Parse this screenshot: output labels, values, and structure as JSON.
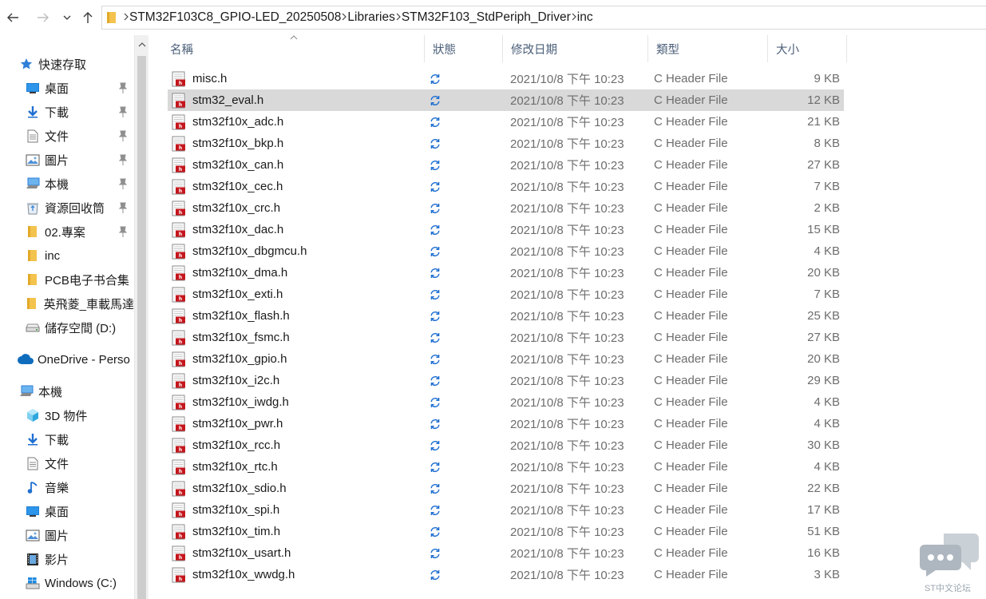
{
  "window": {
    "app": "File Explorer"
  },
  "nav": {
    "back_icon": "arrow-left-icon",
    "forward_icon": "arrow-right-icon",
    "recent_icon": "chevron-down-icon",
    "up_icon": "arrow-up-icon"
  },
  "breadcrumb": [
    "STM32F103C8_GPIO-LED_20250508",
    "Libraries",
    "STM32F103_StdPeriph_Driver",
    "inc"
  ],
  "sidebar": {
    "items": [
      {
        "label": "快速存取",
        "icon": "star-icon",
        "level": 0,
        "pinned": false
      },
      {
        "label": "桌面",
        "icon": "desktop-icon",
        "level": 1,
        "pinned": true
      },
      {
        "label": "下載",
        "icon": "download-icon",
        "level": 1,
        "pinned": true
      },
      {
        "label": "文件",
        "icon": "document-icon",
        "level": 1,
        "pinned": true
      },
      {
        "label": "圖片",
        "icon": "picture-icon",
        "level": 1,
        "pinned": true
      },
      {
        "label": "本機",
        "icon": "computer-icon",
        "level": 1,
        "pinned": true
      },
      {
        "label": "資源回收筒",
        "icon": "recycle-bin-icon",
        "level": 1,
        "pinned": true
      },
      {
        "label": "02.專案",
        "icon": "folder-icon",
        "level": 1,
        "pinned": true
      },
      {
        "label": "inc",
        "icon": "folder-icon",
        "level": 1,
        "pinned": false
      },
      {
        "label": "PCB电子书合集",
        "icon": "folder-icon",
        "level": 1,
        "pinned": false
      },
      {
        "label": "英飛菱_車載馬達",
        "icon": "folder-icon",
        "level": 1,
        "pinned": false
      },
      {
        "label": "儲存空間 (D:)",
        "icon": "drive-icon",
        "level": 1,
        "pinned": false
      },
      {
        "label": "OneDrive - Perso",
        "icon": "cloud-icon",
        "level": 0,
        "pinned": false
      },
      {
        "label": "本機",
        "icon": "computer-icon",
        "level": 0,
        "pinned": false
      },
      {
        "label": "3D 物件",
        "icon": "cube-3d-icon",
        "level": 1,
        "pinned": false
      },
      {
        "label": "下載",
        "icon": "download-icon",
        "level": 1,
        "pinned": false
      },
      {
        "label": "文件",
        "icon": "document-icon",
        "level": 1,
        "pinned": false
      },
      {
        "label": "音樂",
        "icon": "music-icon",
        "level": 1,
        "pinned": false
      },
      {
        "label": "桌面",
        "icon": "desktop-icon",
        "level": 1,
        "pinned": false
      },
      {
        "label": "圖片",
        "icon": "picture-icon",
        "level": 1,
        "pinned": false
      },
      {
        "label": "影片",
        "icon": "video-icon",
        "level": 1,
        "pinned": false
      },
      {
        "label": "Windows (C:)",
        "icon": "windows-drive-icon",
        "level": 1,
        "pinned": false
      }
    ]
  },
  "columns": {
    "name": "名稱",
    "status": "狀態",
    "date": "修改日期",
    "type": "類型",
    "size": "大小"
  },
  "files": [
    {
      "name": "misc.h",
      "date": "2021/10/8 下午 10:23",
      "type": "C Header File",
      "size": "9 KB",
      "selected": false
    },
    {
      "name": "stm32_eval.h",
      "date": "2021/10/8 下午 10:23",
      "type": "C Header File",
      "size": "12 KB",
      "selected": true
    },
    {
      "name": "stm32f10x_adc.h",
      "date": "2021/10/8 下午 10:23",
      "type": "C Header File",
      "size": "21 KB",
      "selected": false
    },
    {
      "name": "stm32f10x_bkp.h",
      "date": "2021/10/8 下午 10:23",
      "type": "C Header File",
      "size": "8 KB",
      "selected": false
    },
    {
      "name": "stm32f10x_can.h",
      "date": "2021/10/8 下午 10:23",
      "type": "C Header File",
      "size": "27 KB",
      "selected": false
    },
    {
      "name": "stm32f10x_cec.h",
      "date": "2021/10/8 下午 10:23",
      "type": "C Header File",
      "size": "7 KB",
      "selected": false
    },
    {
      "name": "stm32f10x_crc.h",
      "date": "2021/10/8 下午 10:23",
      "type": "C Header File",
      "size": "2 KB",
      "selected": false
    },
    {
      "name": "stm32f10x_dac.h",
      "date": "2021/10/8 下午 10:23",
      "type": "C Header File",
      "size": "15 KB",
      "selected": false
    },
    {
      "name": "stm32f10x_dbgmcu.h",
      "date": "2021/10/8 下午 10:23",
      "type": "C Header File",
      "size": "4 KB",
      "selected": false
    },
    {
      "name": "stm32f10x_dma.h",
      "date": "2021/10/8 下午 10:23",
      "type": "C Header File",
      "size": "20 KB",
      "selected": false
    },
    {
      "name": "stm32f10x_exti.h",
      "date": "2021/10/8 下午 10:23",
      "type": "C Header File",
      "size": "7 KB",
      "selected": false
    },
    {
      "name": "stm32f10x_flash.h",
      "date": "2021/10/8 下午 10:23",
      "type": "C Header File",
      "size": "25 KB",
      "selected": false
    },
    {
      "name": "stm32f10x_fsmc.h",
      "date": "2021/10/8 下午 10:23",
      "type": "C Header File",
      "size": "27 KB",
      "selected": false
    },
    {
      "name": "stm32f10x_gpio.h",
      "date": "2021/10/8 下午 10:23",
      "type": "C Header File",
      "size": "20 KB",
      "selected": false
    },
    {
      "name": "stm32f10x_i2c.h",
      "date": "2021/10/8 下午 10:23",
      "type": "C Header File",
      "size": "29 KB",
      "selected": false
    },
    {
      "name": "stm32f10x_iwdg.h",
      "date": "2021/10/8 下午 10:23",
      "type": "C Header File",
      "size": "4 KB",
      "selected": false
    },
    {
      "name": "stm32f10x_pwr.h",
      "date": "2021/10/8 下午 10:23",
      "type": "C Header File",
      "size": "4 KB",
      "selected": false
    },
    {
      "name": "stm32f10x_rcc.h",
      "date": "2021/10/8 下午 10:23",
      "type": "C Header File",
      "size": "30 KB",
      "selected": false
    },
    {
      "name": "stm32f10x_rtc.h",
      "date": "2021/10/8 下午 10:23",
      "type": "C Header File",
      "size": "4 KB",
      "selected": false
    },
    {
      "name": "stm32f10x_sdio.h",
      "date": "2021/10/8 下午 10:23",
      "type": "C Header File",
      "size": "22 KB",
      "selected": false
    },
    {
      "name": "stm32f10x_spi.h",
      "date": "2021/10/8 下午 10:23",
      "type": "C Header File",
      "size": "17 KB",
      "selected": false
    },
    {
      "name": "stm32f10x_tim.h",
      "date": "2021/10/8 下午 10:23",
      "type": "C Header File",
      "size": "51 KB",
      "selected": false
    },
    {
      "name": "stm32f10x_usart.h",
      "date": "2021/10/8 下午 10:23",
      "type": "C Header File",
      "size": "16 KB",
      "selected": false
    },
    {
      "name": "stm32f10x_wwdg.h",
      "date": "2021/10/8 下午 10:23",
      "type": "C Header File",
      "size": "3 KB",
      "selected": false
    }
  ],
  "watermark": {
    "text": "ST中文论坛",
    "icon": "chat-bubble-icon"
  },
  "colors": {
    "selected_row": "#d9d9d9",
    "header_text": "#4c607a",
    "folder": "#f4c34d",
    "sync_icon": "#1f6fd1",
    "file_icon_red": "#c4161c"
  }
}
